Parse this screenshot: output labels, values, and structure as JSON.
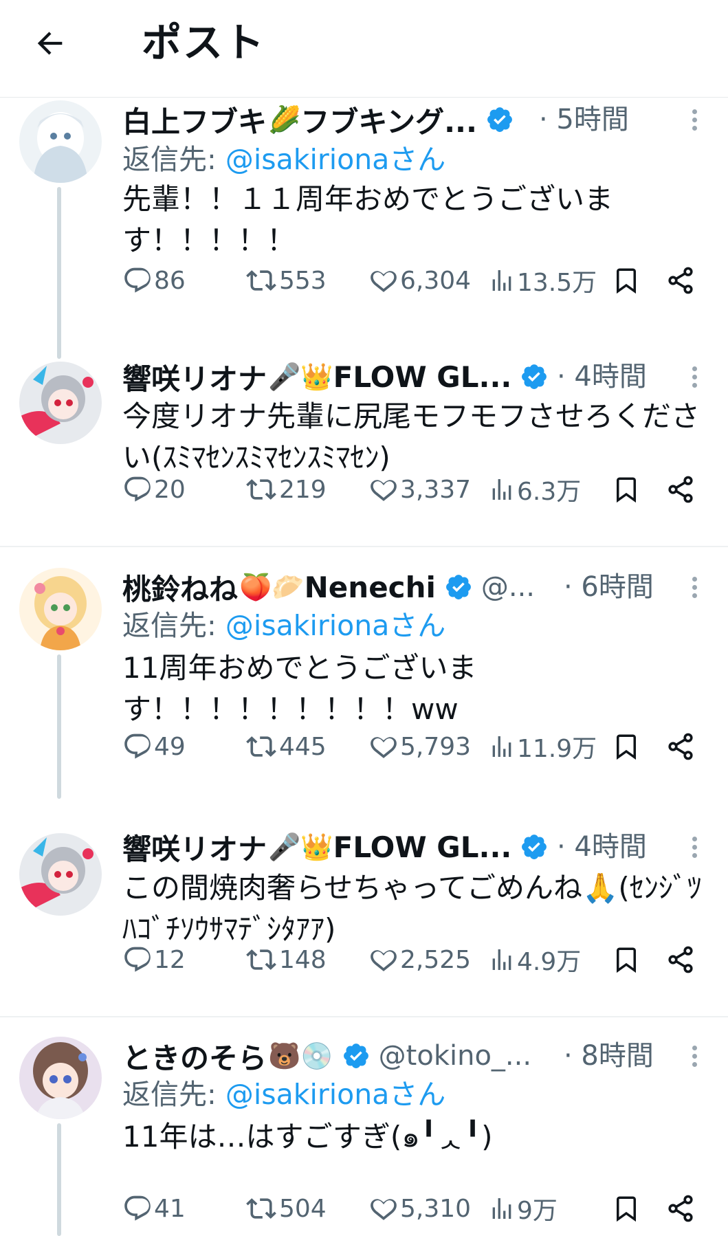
{
  "header": {
    "title": "ポスト"
  },
  "posts": [
    {
      "name": "白上フブキ",
      "name_emoji": "🌽",
      "name_suffix": "フブキング...",
      "time": "· 5時間",
      "reply_label": "返信先: ",
      "reply_handle": "@isakirionaさん",
      "text": "先輩！！１１周年おめでとうございます！！！！！",
      "replies": "86",
      "reposts": "553",
      "likes": "6,304",
      "views": "13.5万",
      "avatar_colors": [
        "#e8eef2",
        "#b8c9d6",
        "#ffffff"
      ]
    },
    {
      "name": "響咲リオナ",
      "name_emoji": "🎤👑",
      "name_suffix": "FLOW GL...",
      "time": "· 4時間",
      "text": "今度リオナ先輩に尻尾モフモフさせろください(ｽﾐﾏｾﾝｽﾐﾏｾﾝｽﾐﾏｾﾝ)",
      "replies": "20",
      "reposts": "219",
      "likes": "3,337",
      "views": "6.3万",
      "avatar_colors": [
        "#d9dde2",
        "#e8325a",
        "#3a3a46"
      ]
    },
    {
      "name": "桃鈴ねね",
      "name_emoji": "🍑🥟",
      "name_suffix": "Nenechi",
      "handle": "@...",
      "time": "· 6時間",
      "reply_label": "返信先: ",
      "reply_handle": "@isakirionaさん",
      "text": "11周年おめでとうございます！！！！！！！！！ww",
      "replies": "49",
      "reposts": "445",
      "likes": "5,793",
      "views": "11.9万",
      "avatar_colors": [
        "#fbe3b8",
        "#f3b65a",
        "#f5c6c6"
      ]
    },
    {
      "name": "響咲リオナ",
      "name_emoji": "🎤👑",
      "name_suffix": "FLOW GL...",
      "time": "· 4時間",
      "text": "この間焼肉奢らせちゃってごめんね🙏(ｾﾝｼﾞﾂﾊｺﾞﾁｿｳｻﾏﾃﾞｼﾀｱｱ)",
      "replies": "12",
      "reposts": "148",
      "likes": "2,525",
      "views": "4.9万",
      "avatar_colors": [
        "#d9dde2",
        "#e8325a",
        "#3a3a46"
      ]
    },
    {
      "name": "ときのそら",
      "name_emoji": "🐻💿",
      "name_suffix": "",
      "handle": "@tokino_...",
      "time": "· 8時間",
      "reply_label": "返信先: ",
      "reply_handle": "@isakirionaさん",
      "text": "11年は…はすごすぎ(๑╹ᆺ╹)",
      "replies": "41",
      "reposts": "504",
      "likes": "5,310",
      "views": "9万",
      "avatar_colors": [
        "#7a5f6e",
        "#c9a7d6",
        "#5a3a46"
      ]
    }
  ],
  "colors": {
    "accent": "#1d9bf0",
    "muted": "#536471",
    "text": "#0f1419",
    "thread": "#cfd9de"
  }
}
